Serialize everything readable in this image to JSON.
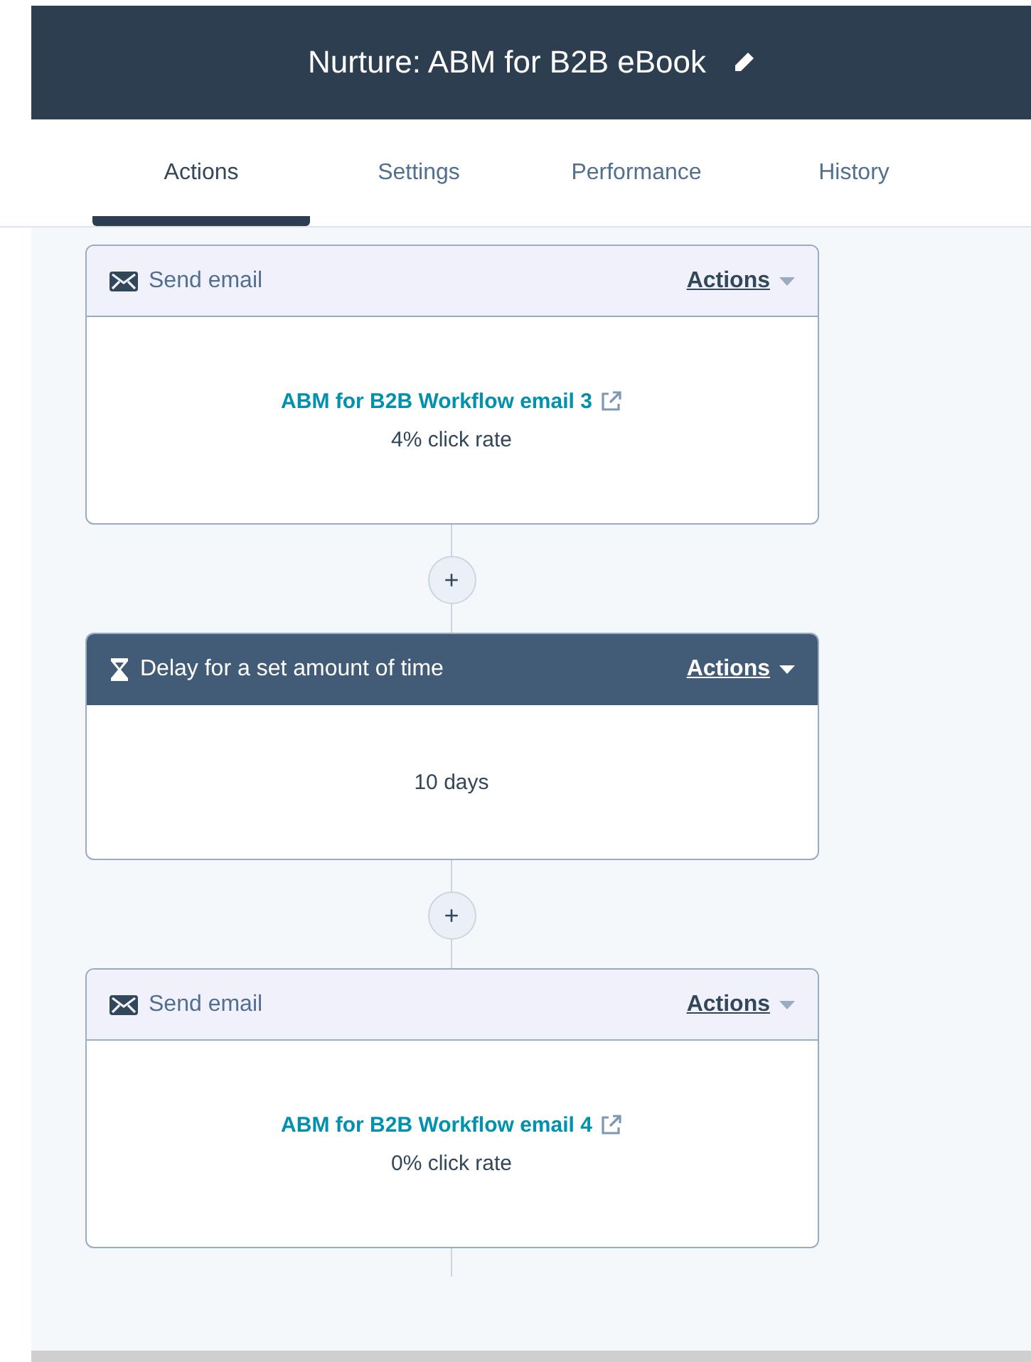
{
  "header": {
    "title": "Nurture: ABM for B2B eBook"
  },
  "tabs": [
    {
      "label": "Actions",
      "selected": true
    },
    {
      "label": "Settings",
      "selected": false
    },
    {
      "label": "Performance",
      "selected": false
    },
    {
      "label": "History",
      "selected": false
    }
  ],
  "steps": [
    {
      "kind": "email",
      "title": "Send email",
      "actions": "Actions",
      "link": "ABM for B2B Workflow email 3",
      "detail": "4% click rate"
    },
    {
      "kind": "delay",
      "title": "Delay for a set amount of time",
      "actions": "Actions",
      "detail": "10 days"
    },
    {
      "kind": "email",
      "title": "Send email",
      "actions": "Actions",
      "link": "ABM for B2B Workflow email 4",
      "detail": "0% click rate"
    }
  ],
  "add_button": "+"
}
